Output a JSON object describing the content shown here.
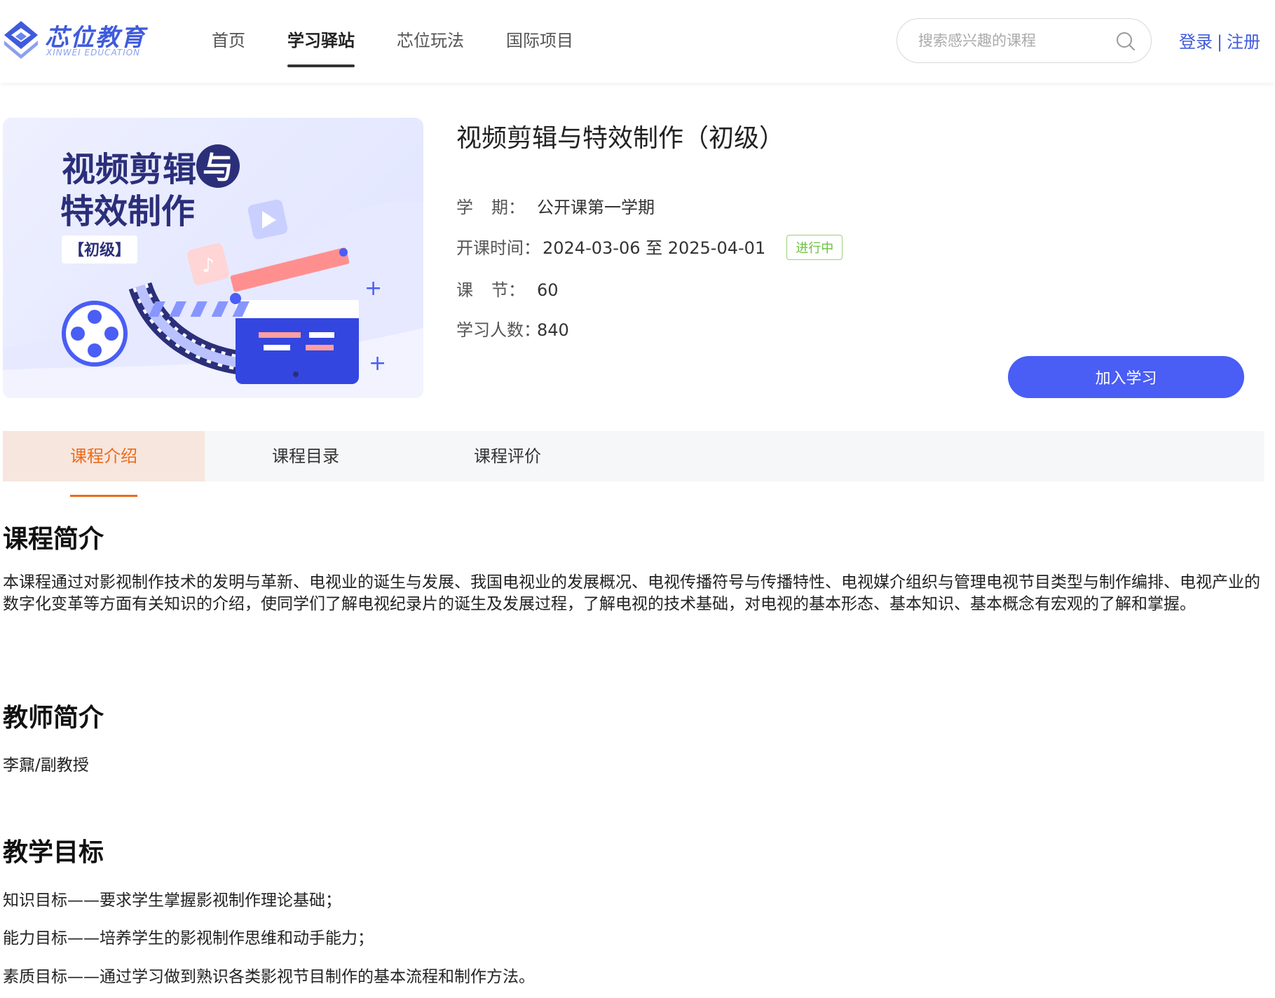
{
  "header": {
    "logo_title": "芯位教育",
    "logo_subtitle": "XINWEI EDUCATION",
    "nav": [
      {
        "label": "首页",
        "active": false
      },
      {
        "label": "学习驿站",
        "active": true
      },
      {
        "label": "芯位玩法",
        "active": false
      },
      {
        "label": "国际项目",
        "active": false
      }
    ],
    "search_placeholder": "搜索感兴趣的课程",
    "login": "登录",
    "separator": "|",
    "register": "注册"
  },
  "cover": {
    "line1": "视频剪辑",
    "badge_char": "与",
    "line2": "特效制作",
    "level": "【初级】"
  },
  "course": {
    "title": "视频剪辑与特效制作（初级）",
    "term_label_a": "学",
    "term_label_b": "期：",
    "term_value": "公开课第一学期",
    "time_label": "开课时间：",
    "time_value": "2024-03-06 至 2025-04-01",
    "status": "进行中",
    "lessons_label_a": "课",
    "lessons_label_b": "节：",
    "lessons_value": "60",
    "learners_label": "学习人数：",
    "learners_value": "840",
    "join_button": "加入学习"
  },
  "tabs": [
    {
      "label": "课程介绍",
      "active": true
    },
    {
      "label": "课程目录",
      "active": false
    },
    {
      "label": "课程评价",
      "active": false
    }
  ],
  "sections": {
    "intro_title": "课程简介",
    "intro_text": "本课程通过对影视制作技术的发明与革新、电视业的诞生与发展、我国电视业的发展概况、电视传播符号与传播特性、电视媒介组织与管理电视节目类型与制作编排、电视产业的数字化变革等方面有关知识的介绍，使同学们了解电视纪录片的诞生及发展过程，了解电视的技术基础，对电视的基本形态、基本知识、基本概念有宏观的了解和掌握。",
    "teacher_title": "教师简介",
    "teacher_text": "李鼐/副教授",
    "goals_title": "教学目标",
    "goals": [
      "知识目标——要求学生掌握影视制作理论基础；",
      "能力目标——培养学生的影视制作思维和动手能力；",
      "素质目标——通过学习做到熟识各类影视节目制作的基本流程和制作方法。"
    ]
  },
  "colors": {
    "brand": "#3f5bdc",
    "primary_button": "#4a5df5",
    "tab_active_text": "#ec6b1c",
    "tab_active_bg": "#f7e6dd",
    "status_green": "#6ac13e"
  }
}
